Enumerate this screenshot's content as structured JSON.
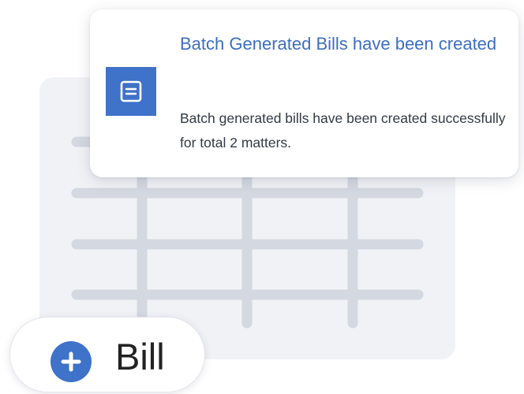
{
  "notification": {
    "title": "Batch Generated Bills have been created",
    "message": "Batch generated bills have been created successfully for total 2 matters.",
    "icon": "document-icon"
  },
  "bill_button": {
    "label": "Bill",
    "icon": "plus-circle-icon"
  },
  "colors": {
    "accent": "#3f72c9",
    "title_text": "#3d6ec2",
    "grid_background": "#f1f2f6",
    "grid_lines": "#d4d8e0"
  }
}
